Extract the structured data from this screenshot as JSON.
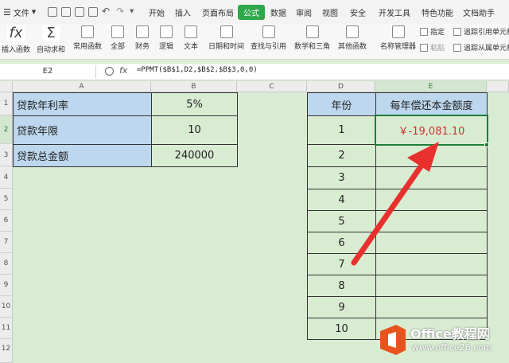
{
  "menubar": {
    "file_label": "文件",
    "tabs": [
      "开始",
      "插入",
      "页面布局",
      "公式",
      "数据",
      "审阅",
      "视图",
      "安全",
      "开发工具",
      "特色功能",
      "文档助手"
    ],
    "active_tab": "公式"
  },
  "ribbon": {
    "buttons": [
      "插入函数",
      "自动求和",
      "常用函数",
      "全部",
      "财务",
      "逻辑",
      "文本",
      "日期和时间",
      "查找与引用",
      "数学和三角",
      "其他函数",
      "名称管理器"
    ],
    "small": [
      "指定",
      "粘贴",
      "追踪引用单元格",
      "追踪从属单元格"
    ]
  },
  "formula_bar": {
    "name_box": "E2",
    "fx": "fx",
    "formula": "=PPMT($B$1,D2,$B$2,$B$3,0,0)"
  },
  "columns": [
    "A",
    "B",
    "C",
    "D",
    "E"
  ],
  "rows": [
    "1",
    "2",
    "3",
    "4",
    "5",
    "6",
    "7",
    "8",
    "9",
    "10",
    "11",
    "12"
  ],
  "left_table": [
    {
      "label": "贷款年利率",
      "value": "5%"
    },
    {
      "label": "贷款年限",
      "value": "10"
    },
    {
      "label": "贷款总金额",
      "value": "240000"
    }
  ],
  "right_table": {
    "header_year": "年份",
    "header_amount": "每年偿还本金额度",
    "years": [
      "1",
      "2",
      "3",
      "4",
      "5",
      "6",
      "7",
      "8",
      "9",
      "10"
    ],
    "e2_value": "￥-19,081.10"
  },
  "watermark": {
    "brand": "Office教程网",
    "url": "www.office26.com"
  },
  "colors": {
    "accent": "#2ea84a",
    "cell_blue": "#bdd7ee",
    "sheet_bg": "#d8ecd2",
    "arrow": "#e8312f"
  }
}
